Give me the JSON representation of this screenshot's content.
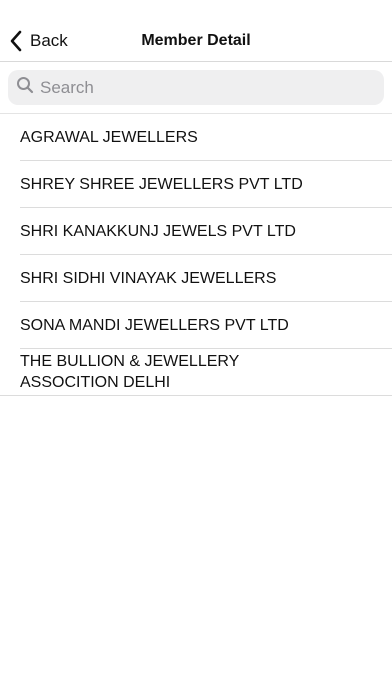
{
  "nav": {
    "back_label": "Back",
    "title": "Member Detail"
  },
  "search": {
    "placeholder": "Search",
    "value": ""
  },
  "members": [
    {
      "name": "AGRAWAL JEWELLERS"
    },
    {
      "name": "SHREY SHREE JEWELLERS PVT LTD"
    },
    {
      "name": "SHRI KANAKKUNJ JEWELS PVT LTD"
    },
    {
      "name": "SHRI SIDHI VINAYAK JEWELLERS"
    },
    {
      "name": "SONA MANDI JEWELLERS PVT LTD"
    },
    {
      "name": "THE BULLION & JEWELLERY ASSOCITION DELHI"
    }
  ],
  "icons": {
    "back": "chevron-left-icon",
    "search": "search-icon"
  }
}
